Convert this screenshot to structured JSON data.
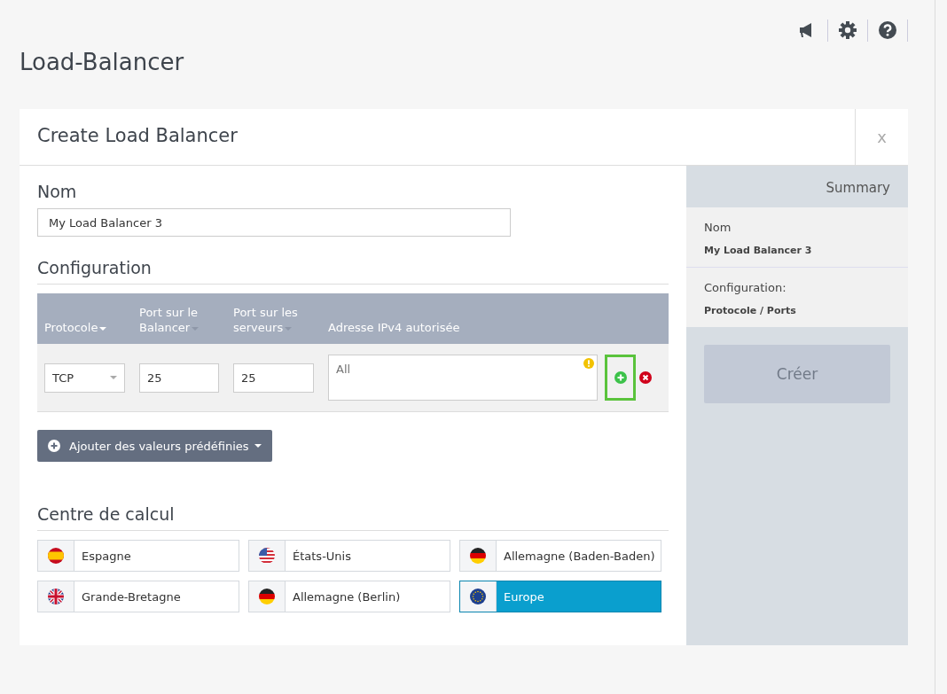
{
  "page_title": "Load-Balancer",
  "dialog": {
    "title": "Create Load Balancer",
    "close": "x"
  },
  "name_section": {
    "heading": "Nom",
    "value": "My Load Balancer 3"
  },
  "configuration": {
    "heading": "Configuration",
    "columns": [
      {
        "label": "Protocole",
        "sortable": true
      },
      {
        "label": "Port sur le Balancer",
        "sortable": true
      },
      {
        "label": "Port sur les serveurs",
        "sortable": true
      },
      {
        "label": "Adresse IPv4 autorisée",
        "sortable": false
      }
    ],
    "rows": [
      {
        "protocol": "TCP",
        "balancer_port": "25",
        "server_port": "25",
        "address_placeholder": "All",
        "warning": true,
        "add_highlighted": true
      }
    ],
    "predefined_button": "Ajouter des valeurs prédéfinies"
  },
  "datacenter": {
    "heading": "Centre de calcul",
    "items": [
      {
        "label": "Espagne",
        "kind": "es",
        "selected": false
      },
      {
        "label": "États-Unis",
        "kind": "us",
        "selected": false
      },
      {
        "label": "Allemagne (Baden-Baden)",
        "kind": "de",
        "selected": false
      },
      {
        "label": "Grande-Bretagne",
        "kind": "gb",
        "selected": false
      },
      {
        "label": "Allemagne (Berlin)",
        "kind": "de",
        "selected": false
      },
      {
        "label": "Europe",
        "kind": "eu",
        "selected": true
      }
    ]
  },
  "summary": {
    "title": "Summary",
    "sections": [
      {
        "label": "Nom",
        "value": "My Load Balancer 3"
      },
      {
        "label": "Configuration:",
        "value": "Protocole / Ports"
      }
    ],
    "create_button": {
      "label": "Créer",
      "disabled": true
    }
  }
}
